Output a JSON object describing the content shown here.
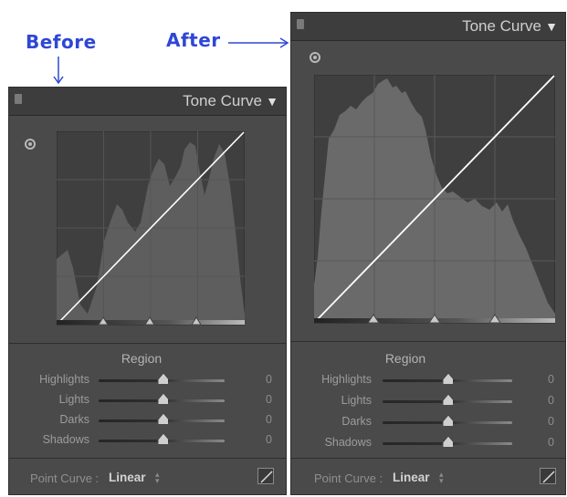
{
  "annotations": {
    "before": "Before",
    "after": "After"
  },
  "panel_title": "Tone Curve",
  "collapse_glyph": "▼",
  "region_title": "Region",
  "point_curve_label": "Point Curve :",
  "point_curve_value": "Linear",
  "sliders": [
    {
      "label": "Highlights",
      "value": "0"
    },
    {
      "label": "Lights",
      "value": "0"
    },
    {
      "label": "Darks",
      "value": "0"
    },
    {
      "label": "Shadows",
      "value": "0"
    }
  ],
  "colors": {
    "annotation": "#2f47d6",
    "panel_bg": "#4a4a4a",
    "graph_bg": "#3f3f3f",
    "histogram": "#6a6a6a",
    "curve_line": "#ffffff"
  },
  "icons": [
    "target-adjustment-icon",
    "collapse-triangle-icon",
    "point-curve-edit-icon",
    "grip-icon"
  ]
}
